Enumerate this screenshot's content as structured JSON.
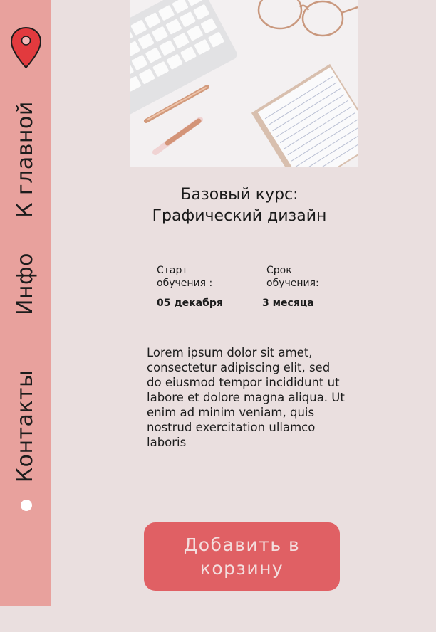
{
  "nav": {
    "home": "К главной",
    "info": "Инфо",
    "contacts": "Контакты"
  },
  "course": {
    "title_line1": "Базовый курс:",
    "title_line2": "Графический дизайн",
    "start_label_1": "Старт",
    "start_label_2": "обучения :",
    "start_value": "05 декабря",
    "duration_label_1": "Срок",
    "duration_label_2": "обучения:",
    "duration_value": "3 месяца",
    "description": "Lorem ipsum dolor sit amet, consectetur adipiscing elit, sed do eiusmod tempor incididunt ut labore et dolore magna aliqua. Ut enim ad minim veniam, quis nostrud exercitation ullamco laboris"
  },
  "cart_button": "Добавить в корзину",
  "icons": {
    "location": "location-pin-icon"
  },
  "colors": {
    "background": "#eadfdf",
    "sidebar": "#e8a19d",
    "accent": "#e06064",
    "pin": "#e23a3e"
  }
}
